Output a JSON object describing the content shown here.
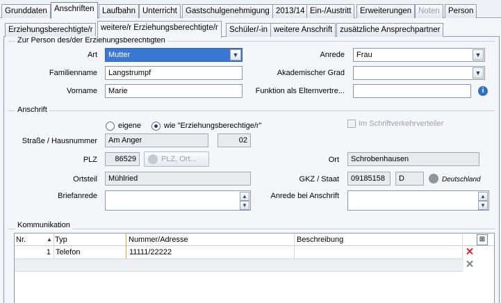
{
  "tabs_main": [
    {
      "label": "Grunddaten"
    },
    {
      "label": "Anschriften"
    },
    {
      "label": "Laufbahn"
    },
    {
      "label": "Unterricht"
    },
    {
      "label": "Gastschulgenehmigung"
    },
    {
      "label": "2013/14"
    },
    {
      "label": "Ein-/Austritt"
    },
    {
      "label": "Erweiterungen"
    },
    {
      "label": "Noten"
    },
    {
      "label": "Person"
    }
  ],
  "tabs_sub": [
    {
      "label": "Erziehungsberechtigte/r"
    },
    {
      "label": "weitere/r Erziehungsberechtigte/r"
    },
    {
      "label": "Schüler/-in"
    },
    {
      "label": "weitere Anschrift"
    },
    {
      "label": "zusätzliche Ansprechpartner"
    }
  ],
  "person": {
    "section_title": "Zur Person des/der Erziehungsberechtigten",
    "art_label": "Art",
    "art_value": "Mutter",
    "familienname_label": "Familienname",
    "familienname_value": "Langstrumpf",
    "vorname_label": "Vorname",
    "vorname_value": "Marie",
    "anrede_label": "Anrede",
    "anrede_value": "Frau",
    "akad_label": "Akademischer Grad",
    "akad_value": "",
    "funktion_label": "Funktion als Elternvertre...",
    "funktion_value": ""
  },
  "anschrift": {
    "section_title": "Anschrift",
    "radio_eigene": "eigene",
    "radio_wie": "wie \"Erziehungsberechtige/r\"",
    "checkbox_label": "Im Schriftverkehrverteiler",
    "strasse_label": "Straße / Hausnummer",
    "strasse_value": "Am Anger",
    "hausnummer_value": "02",
    "plz_label": "PLZ",
    "plz_value": "86529",
    "plz_button": "PLZ, Ort...",
    "ort_label": "Ort",
    "ort_value": "Schrobenhausen",
    "ortsteil_label": "Ortsteil",
    "ortsteil_value": "Mühlried",
    "gkz_label": "GKZ / Staat",
    "gkz_value": "09185158",
    "staat_value": "D",
    "staat_name": "Deutschland",
    "briefanrede_label": "Briefanrede",
    "briefanrede_value": "",
    "anrede_anschrift_label": "Anrede bei Anschrift",
    "anrede_anschrift_value": ""
  },
  "kommunikation": {
    "section_title": "Kommunikation",
    "columns": [
      "Nr.",
      "Typ",
      "Nummer/Adresse",
      "Beschreibung"
    ],
    "rows": [
      {
        "nr": "1",
        "typ": "Telefon",
        "nummer": "11111/22222",
        "beschreibung": ""
      }
    ]
  },
  "colors": {
    "selected_field": "#3a78d6",
    "delete_red": "#d42a2a"
  }
}
